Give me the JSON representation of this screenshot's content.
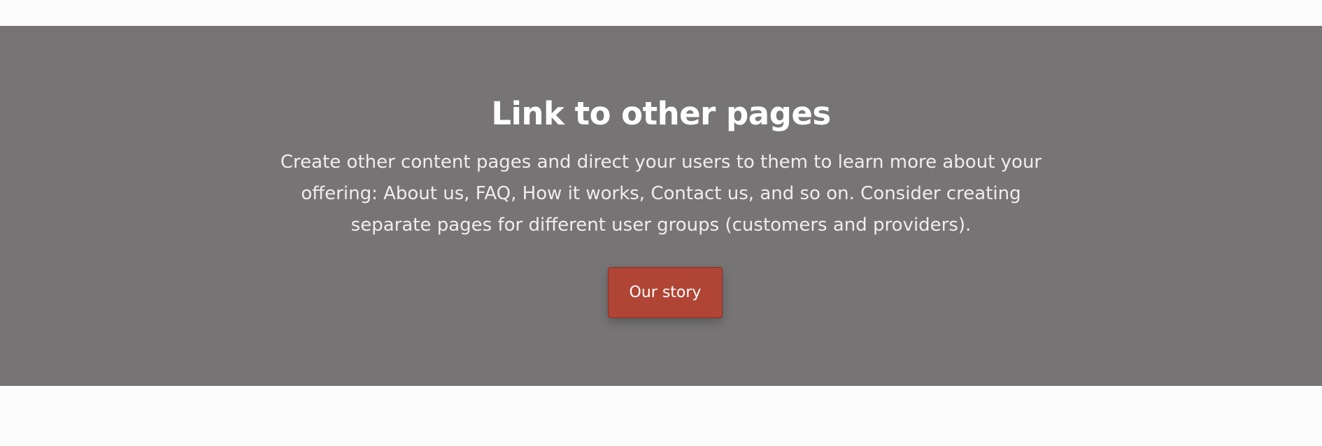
{
  "section": {
    "title": "Link to other pages",
    "body": "Create other content pages and direct your users to them to learn more about your offering: About us, FAQ, How it works, Contact us, and so on. Consider creating separate pages for different user groups (customers and providers).",
    "button_label": "Our story"
  },
  "colors": {
    "page_background": "#fcfcfc",
    "hero_background": "#767475",
    "button_background": "#b04535",
    "title_text": "#ffffff",
    "body_text": "#efedee"
  }
}
